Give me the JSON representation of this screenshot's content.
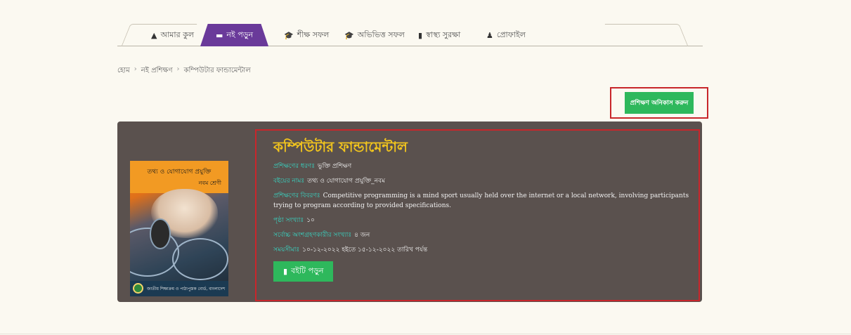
{
  "tabs": [
    {
      "icon": "home-icon",
      "glyph": "▲",
      "label": "আমার কুল"
    },
    {
      "icon": "book-icon",
      "glyph": "▬",
      "label": "নই পড়ুন"
    },
    {
      "icon": "teacher-icon",
      "glyph": "🎓",
      "label": "শীক্ষ সফল"
    },
    {
      "icon": "graduate-icon",
      "glyph": "🎓",
      "label": "অভিভিত্ত সফল"
    },
    {
      "icon": "document-icon",
      "glyph": "▮",
      "label": "স্বাস্থ্য সুরক্ষা"
    },
    {
      "icon": "user-icon",
      "glyph": "♟",
      "label": "প্রোফাইল"
    }
  ],
  "breadcrumb": [
    "হোম",
    "নই প্রশিক্ষণ",
    "কম্পিউটার ফান্ডামেন্টাল"
  ],
  "action_button": "প্রশিক্ষণ অনিকাস করুন",
  "course": {
    "title": "কম্পিউটার ফান্ডামেন্টাল",
    "type_label": "প্রশিক্ষণের ধরণঃ",
    "type_value": "ভুক্তি প্রশিক্ষণ",
    "book_label": "বইয়ের নামঃ",
    "book_value": "তথ্য ও যোগাযোগ প্রযুক্তি_নবম",
    "desc_label": "প্রশিক্ষণের বিবরণঃ",
    "desc_value": "Competitive programming is a mind sport usually held over the internet or a local network, involving participants trying to program according to provided specifications.",
    "pages_label": "পৃষ্ঠা সংখ্যাঃ",
    "pages_value": "১০",
    "participants_label": "সর্বোচ্চ অংশগ্রহণকারীর সংখ্যাঃ",
    "participants_value": "৪ জন",
    "deadline_label": "সময়সীমাঃ",
    "deadline_value": "১০-১২-২০২২ হইতে ১৫-১২-২০২২ তারিখ পর্যন্ত",
    "read_button": "বইটি পড়ুন"
  },
  "cover": {
    "title": "তথ্য ও যোগাযোগ প্রযুক্তি",
    "subtitle": "নবম শ্রেণী",
    "footer": "জাতীয় শিক্ষাক্রম ও পাঠ্যপুস্তক বোর্ড, বাংলাদেশ"
  }
}
